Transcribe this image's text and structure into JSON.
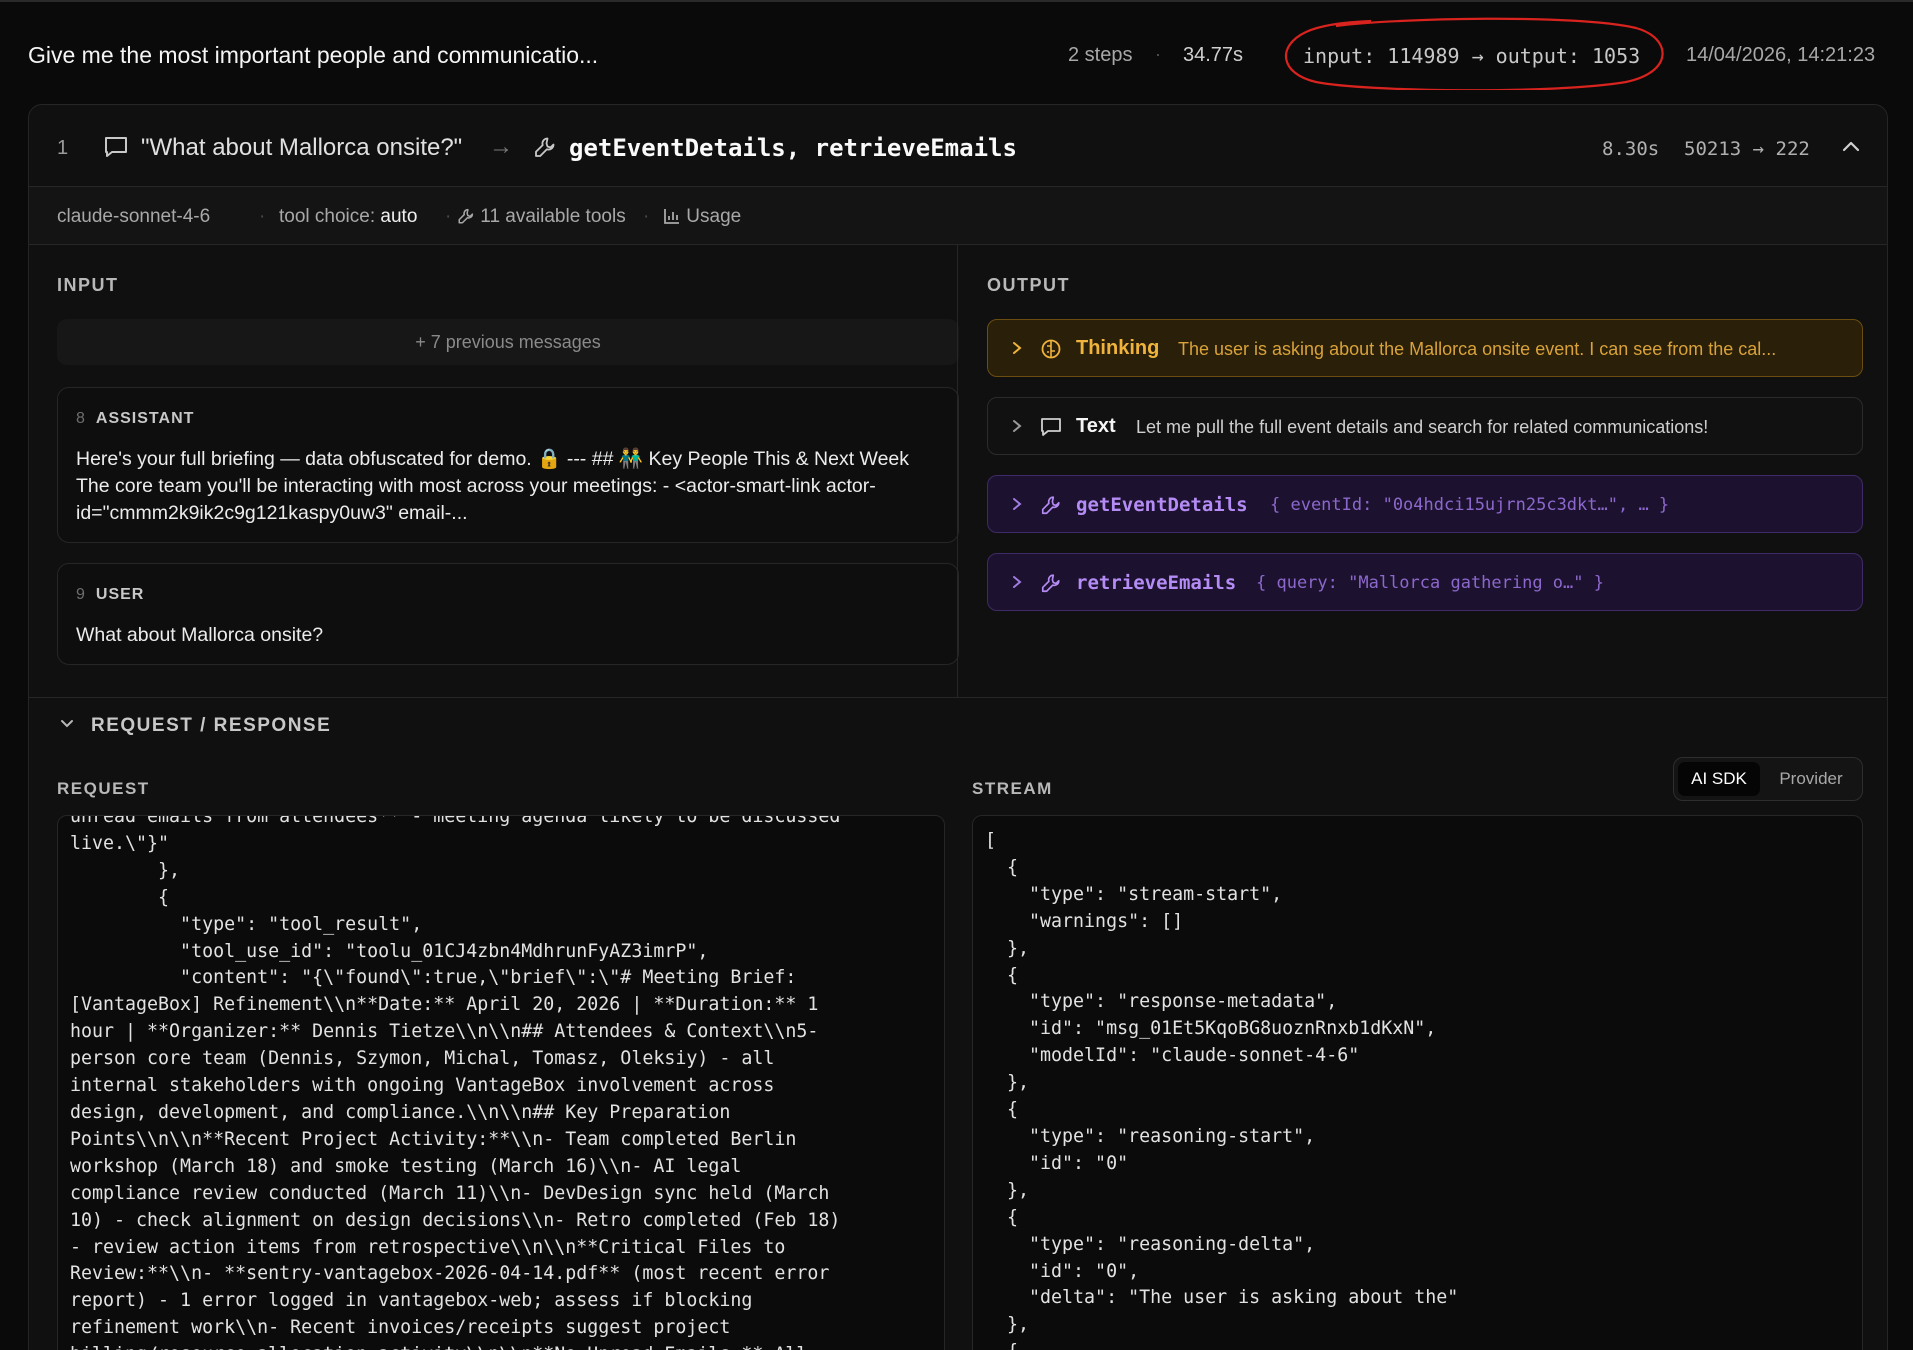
{
  "header": {
    "title": "Give me the most important people and communicatio...",
    "steps": "2 steps",
    "duration": "34.77s",
    "tokens": "input: 114989 → output: 1053",
    "timestamp": "14/04/2026, 14:21:23"
  },
  "step": {
    "number": "1",
    "query": "\"What about Mallorca onsite?\"",
    "arrow": "→",
    "tools": "getEventDetails, retrieveEmails",
    "time": "8.30s",
    "tokens": "50213 → 222",
    "model": "claude-sonnet-4-6",
    "tool_choice_label": "tool choice:",
    "tool_choice_value": "auto",
    "available_tools": "11 available tools",
    "usage": "Usage"
  },
  "input": {
    "label": "INPUT",
    "previous": "+ 7 previous messages",
    "messages": [
      {
        "index": "8",
        "role": "ASSISTANT",
        "text": "Here's your full briefing — data obfuscated for demo. 🔒 --- ## 👬 Key People This & Next Week The core team you'll be interacting with most across your meetings: - <actor-smart-link actor-id=\"cmmm2k9ik2c9g121kaspy0uw3\" email-..."
      },
      {
        "index": "9",
        "role": "USER",
        "text": "What about Mallorca onsite?"
      }
    ]
  },
  "output": {
    "label": "OUTPUT",
    "thinking": {
      "label": "Thinking",
      "text": "The user is asking about the Mallorca onsite event. I can see from the cal..."
    },
    "text_item": {
      "label": "Text",
      "text": "Let me pull the full event details and search for related communications!"
    },
    "tool_calls": [
      {
        "name": "getEventDetails",
        "args": "{ eventId: \"0o4hdci15ujrn25c3dkt…\", … }"
      },
      {
        "name": "retrieveEmails",
        "args": "{ query: \"Mallorca gathering o…\" }"
      }
    ]
  },
  "request_response": {
    "title": "REQUEST / RESPONSE",
    "request_label": "REQUEST",
    "stream_label": "STREAM",
    "toggle_options": [
      "AI SDK",
      "Provider"
    ],
    "request_body": "unread emails from attendees** - meeting agenda likely to be discussed\nlive.\\\"}\"\n        },\n        {\n          \"type\": \"tool_result\",\n          \"tool_use_id\": \"toolu_01CJ4zbn4MdhrunFyAZ3imrP\",\n          \"content\": \"{\\\"found\\\":true,\\\"brief\\\":\\\"# Meeting Brief:\n[VantageBox] Refinement\\\\n**Date:** April 20, 2026 | **Duration:** 1\nhour | **Organizer:** Dennis Tietze\\\\n\\\\n## Attendees & Context\\\\n5-\nperson core team (Dennis, Szymon, Michal, Tomasz, Oleksiy) - all\ninternal stakeholders with ongoing VantageBox involvement across\ndesign, development, and compliance.\\\\n\\\\n## Key Preparation\nPoints\\\\n\\\\n**Recent Project Activity:**\\\\n- Team completed Berlin\nworkshop (March 18) and smoke testing (March 16)\\\\n- AI legal\ncompliance review conducted (March 11)\\\\n- DevDesign sync held (March\n10) - check alignment on design decisions\\\\n- Retro completed (Feb 18)\n- review action items from retrospective\\\\n\\\\n**Critical Files to\nReview:**\\\\n- **sentry-vantagebox-2026-04-14.pdf** (most recent error\nreport) - 1 error logged in vantagebox-web; assess if blocking\nrefinement work\\\\n- Recent invoices/receipts suggest project\nbilling/resource allocation activity\\\\n\\\\n**No Unread Emails:** All",
    "stream_body": "[\n  {\n    \"type\": \"stream-start\",\n    \"warnings\": []\n  },\n  {\n    \"type\": \"response-metadata\",\n    \"id\": \"msg_01Et5KqoBG8uoznRnxb1dKxN\",\n    \"modelId\": \"claude-sonnet-4-6\"\n  },\n  {\n    \"type\": \"reasoning-start\",\n    \"id\": \"0\"\n  },\n  {\n    \"type\": \"reasoning-delta\",\n    \"id\": \"0\",\n    \"delta\": \"The user is asking about the\"\n  },\n  {"
  },
  "colors": {
    "annotation_circle": "#d8231e",
    "thinking_accent": "#f0b43c",
    "tool_accent": "#b58cf5"
  }
}
